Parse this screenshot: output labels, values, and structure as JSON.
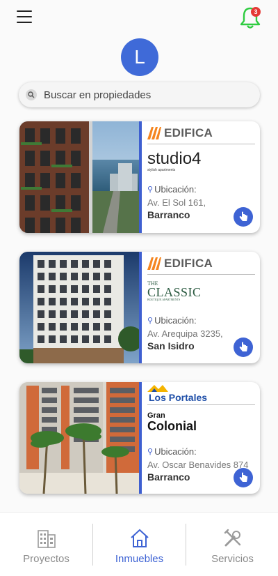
{
  "header": {
    "notification_count": "3"
  },
  "avatar": {
    "initial": "L"
  },
  "search": {
    "placeholder": "Buscar en propiedades"
  },
  "cards": [
    {
      "developer": "EDIFICA",
      "project_name": "studio4",
      "project_sub": "stylish apartments",
      "location_label": "Ubicación:",
      "address": "Av. El Sol 161,",
      "district": "Barranco"
    },
    {
      "developer": "EDIFICA",
      "project_name_top": "THE",
      "project_name": "CLASSIC",
      "project_sub": "BOUTIQUE APARTMENTS",
      "location_label": "Ubicación:",
      "address": "Av. Arequipa 3235,",
      "district": "San Isidro"
    },
    {
      "developer": "Los Portales",
      "project_name_top": "Gran",
      "project_name": "Colonial",
      "location_label": "Ubicación:",
      "address": "Av. Oscar Benavides 874",
      "district": "Barranco"
    }
  ],
  "bottom_nav": [
    {
      "label": "Proyectos",
      "icon": "building-icon"
    },
    {
      "label": "Inmuebles",
      "icon": "home-icon"
    },
    {
      "label": "Servicios",
      "icon": "tools-icon"
    }
  ],
  "colors": {
    "accent": "#3e63d4",
    "badge": "#e53935",
    "bell": "#2ecc40"
  }
}
